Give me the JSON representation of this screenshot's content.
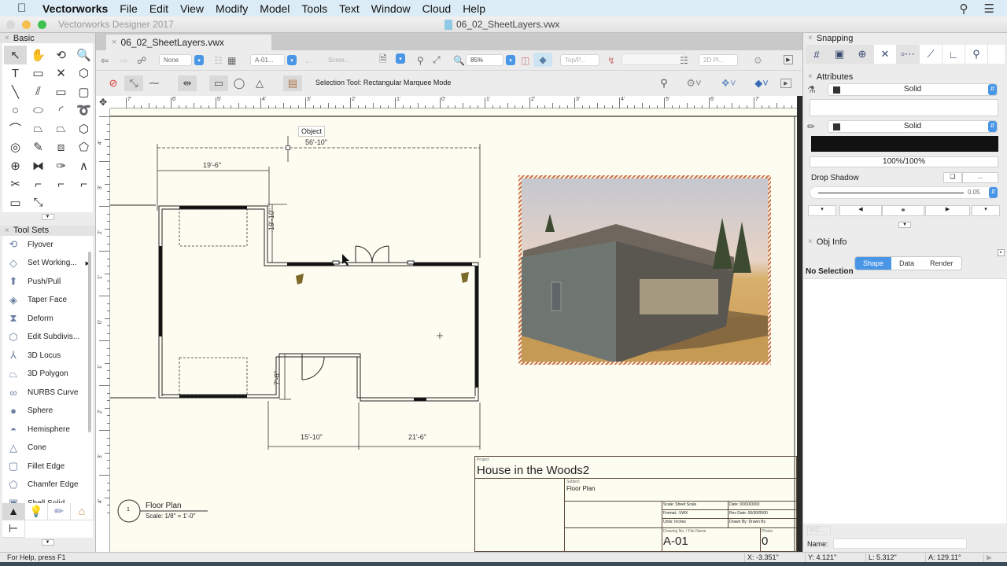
{
  "menubar": {
    "apple": "",
    "items": [
      "Vectorworks",
      "File",
      "Edit",
      "View",
      "Modify",
      "Model",
      "Tools",
      "Text",
      "Window",
      "Cloud",
      "Help"
    ],
    "right_icons": [
      "search-icon",
      "list-icon"
    ]
  },
  "window": {
    "app_title": "Vectorworks Designer 2017",
    "doc_title": "06_02_SheetLayers.vwx",
    "traffic_colors": [
      "#d8d8d8",
      "#f6be4f",
      "#3fc250"
    ]
  },
  "doc_tab": {
    "label": "06_02_SheetLayers.vwx",
    "close": "×"
  },
  "view_bar": {
    "class_value": "None",
    "layer_value": "A-01...",
    "render_value": "Scree...",
    "zoom_value": "85%",
    "view_value": "Top/P...",
    "plane_value": "2D Pl..."
  },
  "mode_bar": {
    "status_text": "Selection Tool: Rectangular Marquee Mode"
  },
  "basic_palette": {
    "title": "Basic",
    "tools": [
      "↖",
      "✋",
      "⟲",
      "🔍",
      "T",
      "▭",
      "✕",
      "⬡",
      "╲",
      "⫽",
      "▭",
      "▢",
      "○",
      "⬭",
      "◜",
      "➰",
      "⌒",
      "⏢",
      "⏢",
      "⬡",
      "◎",
      "✎",
      "⧈",
      "⬠",
      "⊕",
      "⧓",
      "✑",
      "∧",
      "✂",
      "⌐",
      "⌐",
      "⌐",
      "▭",
      "⤡"
    ]
  },
  "tool_sets": {
    "title": "Tool Sets",
    "items": [
      {
        "label": "Flyover",
        "icon": "flyover-icon",
        "glyph": "⟲"
      },
      {
        "label": "Set Working...",
        "icon": "working-plane-icon",
        "glyph": "◇",
        "submenu": "▶"
      },
      {
        "label": "Push/Pull",
        "icon": "push-pull-icon",
        "glyph": "⬆"
      },
      {
        "label": "Taper Face",
        "icon": "taper-face-icon",
        "glyph": "◈"
      },
      {
        "label": "Deform",
        "icon": "deform-icon",
        "glyph": "⧗"
      },
      {
        "label": "Edit Subdivis...",
        "icon": "subdivision-icon",
        "glyph": "⬡"
      },
      {
        "label": "3D Locus",
        "icon": "3d-locus-icon",
        "glyph": "⅄"
      },
      {
        "label": "3D Polygon",
        "icon": "3d-polygon-icon",
        "glyph": "⏢"
      },
      {
        "label": "NURBS Curve",
        "icon": "nurbs-curve-icon",
        "glyph": "∞"
      },
      {
        "label": "Sphere",
        "icon": "sphere-icon",
        "glyph": "●"
      },
      {
        "label": "Hemisphere",
        "icon": "hemisphere-icon",
        "glyph": "◓"
      },
      {
        "label": "Cone",
        "icon": "cone-icon",
        "glyph": "△"
      },
      {
        "label": "Fillet Edge",
        "icon": "fillet-edge-icon",
        "glyph": "▢"
      },
      {
        "label": "Chamfer Edge",
        "icon": "chamfer-edge-icon",
        "glyph": "⬠"
      },
      {
        "label": "Shell Solid",
        "icon": "shell-solid-icon",
        "glyph": "▣"
      }
    ],
    "tabs": [
      "3d-modeling-tab",
      "visualization-tab",
      "dims-notes-tab",
      "building-shell-tab",
      "detailing-tab"
    ]
  },
  "snapping": {
    "title": "Snapping",
    "buttons": [
      "snap-grid",
      "snap-object",
      "snap-angle",
      "snap-intersection",
      "snap-distance",
      "snap-tangent",
      "snap-points",
      "snap-surface"
    ]
  },
  "attributes": {
    "title": "Attributes",
    "fill_style": "Solid",
    "pen_style": "Solid",
    "opacity": "100%/100%",
    "drop_shadow_label": "Drop Shadow",
    "drop_shadow_btn": "...",
    "line_thickness": "0.05"
  },
  "obj_info": {
    "title": "Obj Info",
    "tabs": [
      "Shape",
      "Data",
      "Render"
    ],
    "active_tab": "Shape",
    "selection": "No Selection",
    "ifc_label": "IFC...",
    "name_label": "Name:"
  },
  "canvas": {
    "tooltip": "Object",
    "dimensions": {
      "overall": "56'-10\"",
      "left_wing": "19'-6\"",
      "wing_depth": "19'-10\"",
      "entry_depth": "7'-6\"",
      "bottom_mid": "15'-10\"",
      "bottom_right": "21'-6\""
    },
    "floor_plan_label": {
      "number": "1",
      "title": "Floor Plan",
      "scale": "Scale: 1/8\" = 1'-0\""
    },
    "title_block": {
      "project_label": "Project",
      "project": "House in the Woods2",
      "subject_label": "Subject",
      "subject": "Floor Plan",
      "scale": "Scale: Sheet Scale",
      "format": "Format: .VWX",
      "units": "Units: Inches",
      "date": "Date: 00/00/0000",
      "rev_date": "Rev Date: 00/00/0000",
      "drawn_by": "Drawn By: Drawn By",
      "drawing_no_label": "Drawing No. / File Name",
      "drawing_no": "A-01",
      "phase_label": "Phase",
      "phase": "0"
    },
    "ruler_h_labels": [
      "7'",
      "6'",
      "5'",
      "4'",
      "3'",
      "2'",
      "1'",
      "0'",
      "1'",
      "2'",
      "3'",
      "4'",
      "5'",
      "6'",
      "7'"
    ],
    "ruler_v_labels": [
      "4'",
      "3'",
      "2'",
      "1'",
      "0'",
      "1'",
      "2'",
      "3'",
      "4'"
    ]
  },
  "status": {
    "help": "For Help, press F1",
    "x": "X: -3.351\"",
    "y": "Y: 4.121\"",
    "l": "L: 5.312\"",
    "a": "A: 129.11°"
  }
}
